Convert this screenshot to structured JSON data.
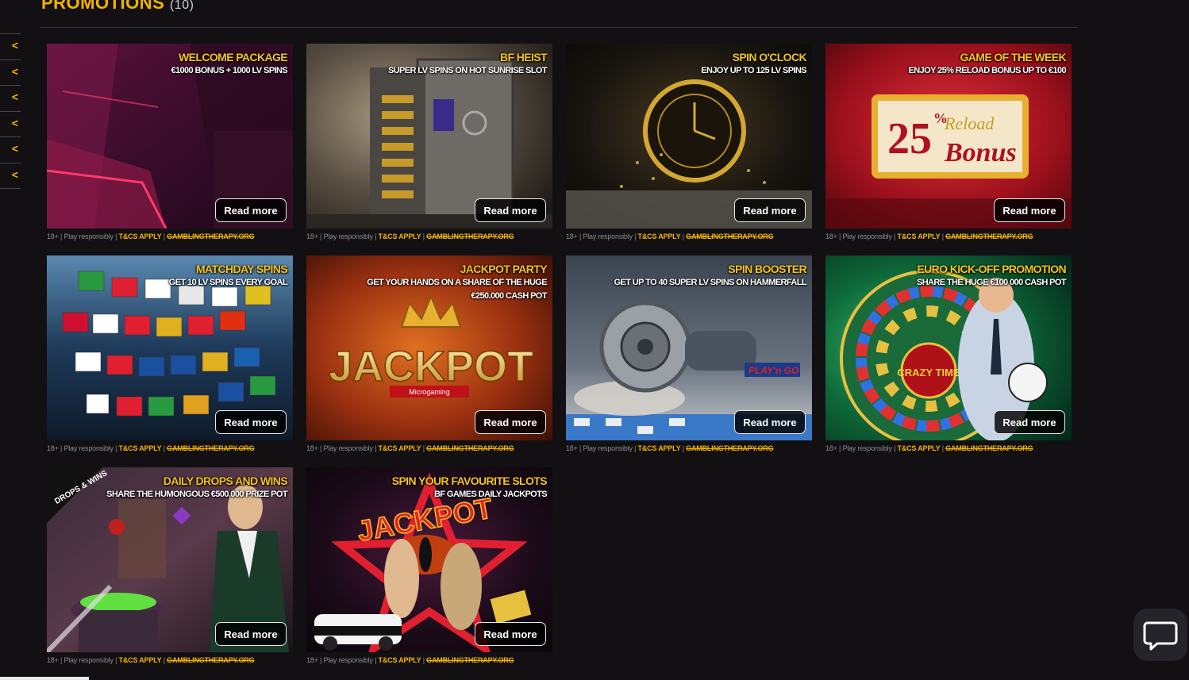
{
  "header": {
    "title": "PROMOTIONS",
    "count": "(10)"
  },
  "side_nav": {
    "items": [
      "<",
      "<",
      "<",
      "<",
      "<",
      "<"
    ]
  },
  "promotions": [
    {
      "title": "WELCOME PACKAGE",
      "subtitle": "€1000 BONUS + 1000 LV SPINS",
      "button": "Read more"
    },
    {
      "title": "BF HEIST",
      "subtitle": "SUPER LV SPINS ON HOT SUNRISE SLOT",
      "button": "Read more"
    },
    {
      "title": "SPIN O'CLOCK",
      "subtitle": "ENJOY UP TO 125 LV SPINS",
      "button": "Read more"
    },
    {
      "title": "GAME OF THE WEEK",
      "subtitle": "ENJOY 25% RELOAD BONUS UP TO €100",
      "button": "Read more"
    },
    {
      "title": "MATCHDAY SPINS",
      "subtitle": "GET 10 LV SPINS EVERY GOAL",
      "button": "Read more"
    },
    {
      "title": "JACKPOT PARTY",
      "subtitle": "GET YOUR HANDS ON A SHARE OF THE HUGE €250.000 CASH POT",
      "button": "Read more"
    },
    {
      "title": "SPIN BOOSTER",
      "subtitle": "GET UP TO 40 SUPER LV SPINS ON HAMMERFALL",
      "button": "Read more"
    },
    {
      "title": "EURO KICK-OFF PROMOTION",
      "subtitle": "SHARE THE HUGE €100 000 CASH POT",
      "button": "Read more"
    },
    {
      "title": "DAILY DROPS AND WINS",
      "subtitle": "SHARE THE HUMONGOUS €500.000 PRIZE POT",
      "button": "Read more"
    },
    {
      "title": "SPIN YOUR FAVOURITE SLOTS",
      "subtitle": "BF GAMES DAILY JACKPOTS",
      "button": "Read more"
    }
  ],
  "banner_art": {
    "reload_number": "25",
    "reload_percent": "%",
    "reload_word": "Reload",
    "bonus_word": "Bonus",
    "jackpot_word": "JACKPOT",
    "microgaming": "Microgaming",
    "playngo": "PLAY'n GO",
    "crazy_time": "CRAZY TIME",
    "drops_wins": "DROPS & WINS",
    "jackpot_neon": "JACKPOT"
  },
  "disclaimer": {
    "age": "18+",
    "play": "Play responsibly",
    "tc": "T&CS APPLY",
    "gamcare": "GAMBLINGTHERAPY.ORG",
    "sep": "|"
  },
  "colors": {
    "accent": "#f5b400",
    "background": "#121012"
  },
  "icons": {
    "chat": "chat-bubble-icon",
    "nav": "chevron-left-icon"
  }
}
